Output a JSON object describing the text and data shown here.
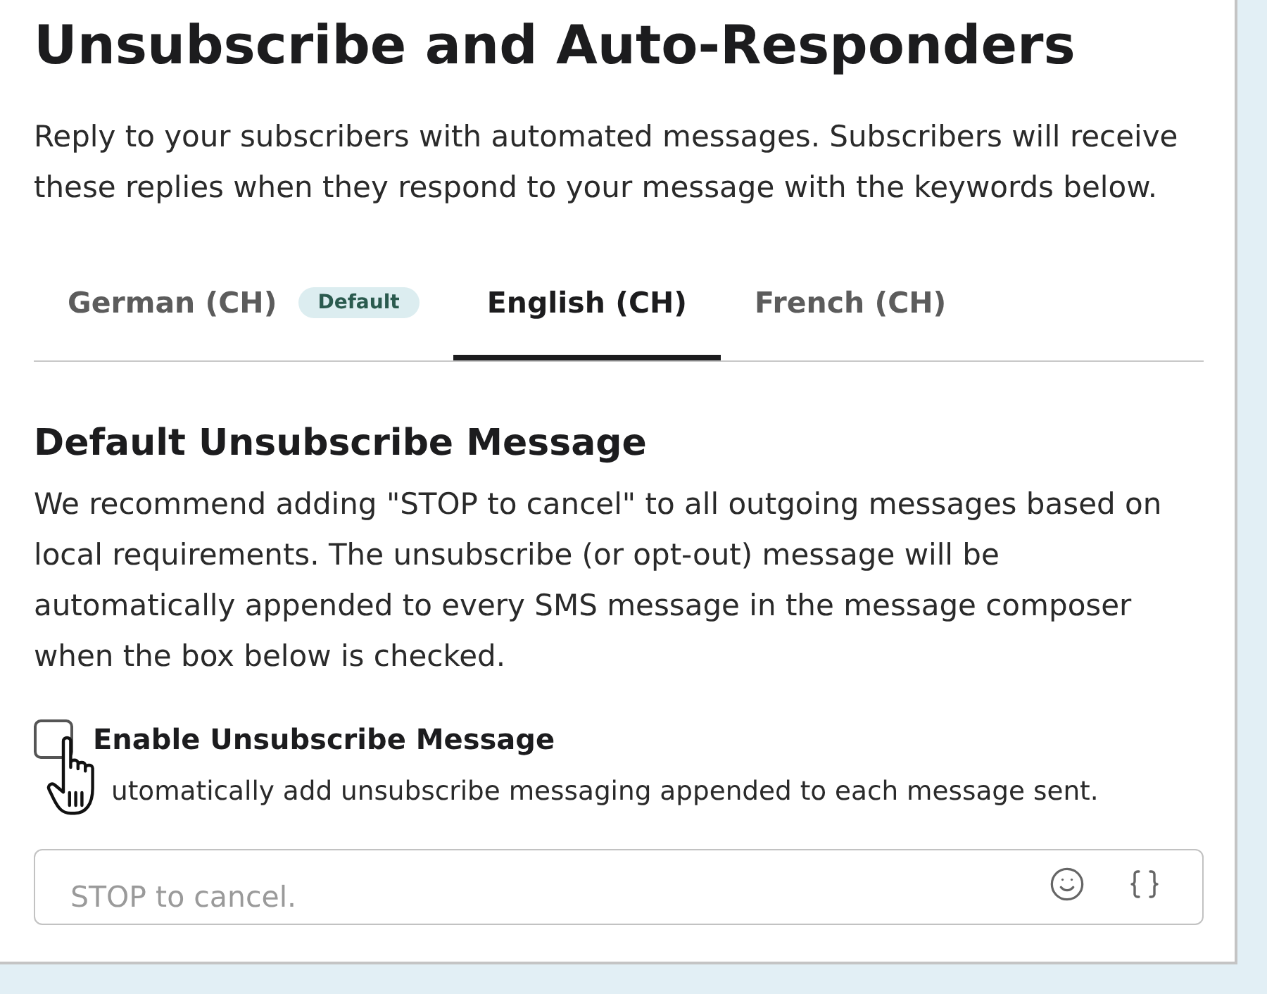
{
  "header": {
    "title": "Unsubscribe and Auto-Responders",
    "description": "Reply to your subscribers with automated messages. Subscribers will receive these replies when they respond to your message with the keywords below."
  },
  "tabs": [
    {
      "label": "German (CH)",
      "badge": "Default",
      "selected": false
    },
    {
      "label": "English (CH)",
      "selected": true
    },
    {
      "label": "French (CH)",
      "selected": false
    }
  ],
  "section": {
    "title": "Default Unsubscribe Message",
    "description": "We recommend adding \"STOP to cancel\" to all outgoing messages based on local requirements. The unsubscribe (or opt-out) message will be automatically appended to every SMS message in the message composer when the box below is checked."
  },
  "checkbox": {
    "label": "Enable Unsubscribe Message",
    "hint": "utomatically add unsubscribe messaging appended to each message sent.",
    "checked": false
  },
  "message_field": {
    "placeholder": "STOP to cancel."
  }
}
